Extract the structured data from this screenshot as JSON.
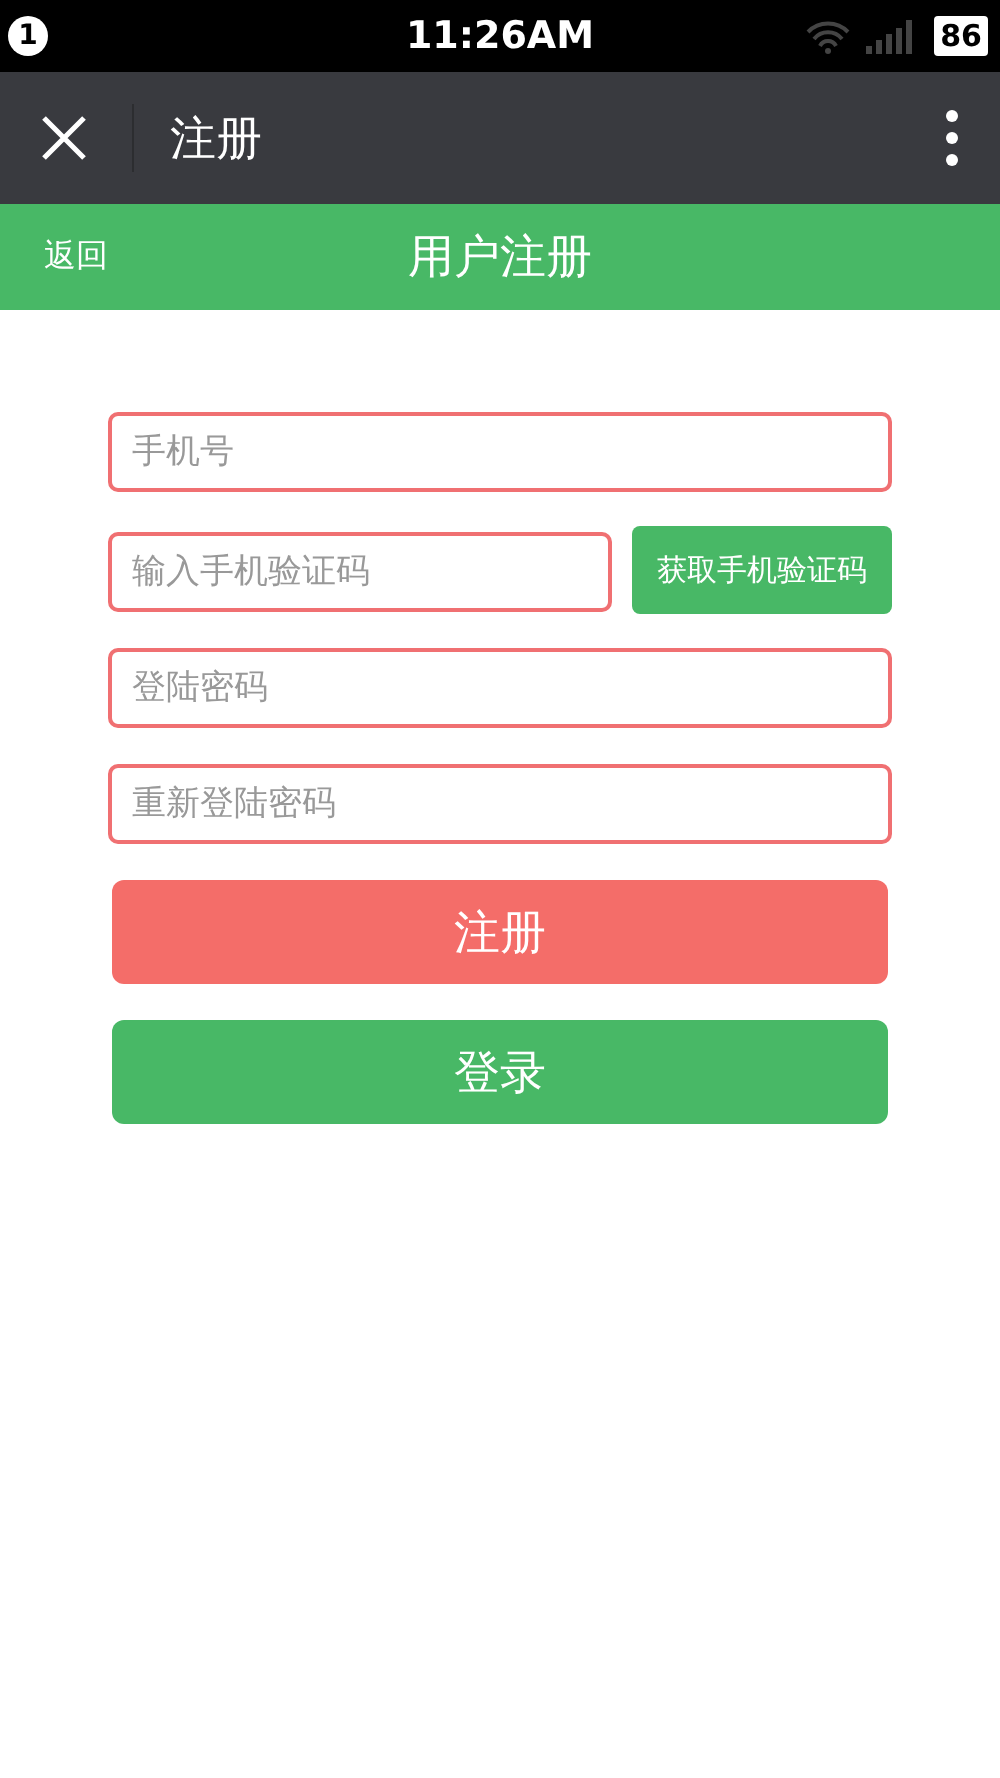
{
  "status_bar": {
    "notification_count": "1",
    "time": "11:26AM",
    "battery": "86"
  },
  "nav_bar": {
    "title": "注册"
  },
  "header": {
    "back": "返回",
    "title": "用户注册"
  },
  "form": {
    "phone": {
      "placeholder": "手机号"
    },
    "code": {
      "placeholder": "输入手机验证码",
      "button": "获取手机验证码"
    },
    "password": {
      "placeholder": "登陆密码"
    },
    "confirm_password": {
      "placeholder": "重新登陆密码"
    }
  },
  "buttons": [
    {
      "label": "注册",
      "kind": "primary"
    },
    {
      "label": "登录",
      "kind": "secondary"
    }
  ]
}
